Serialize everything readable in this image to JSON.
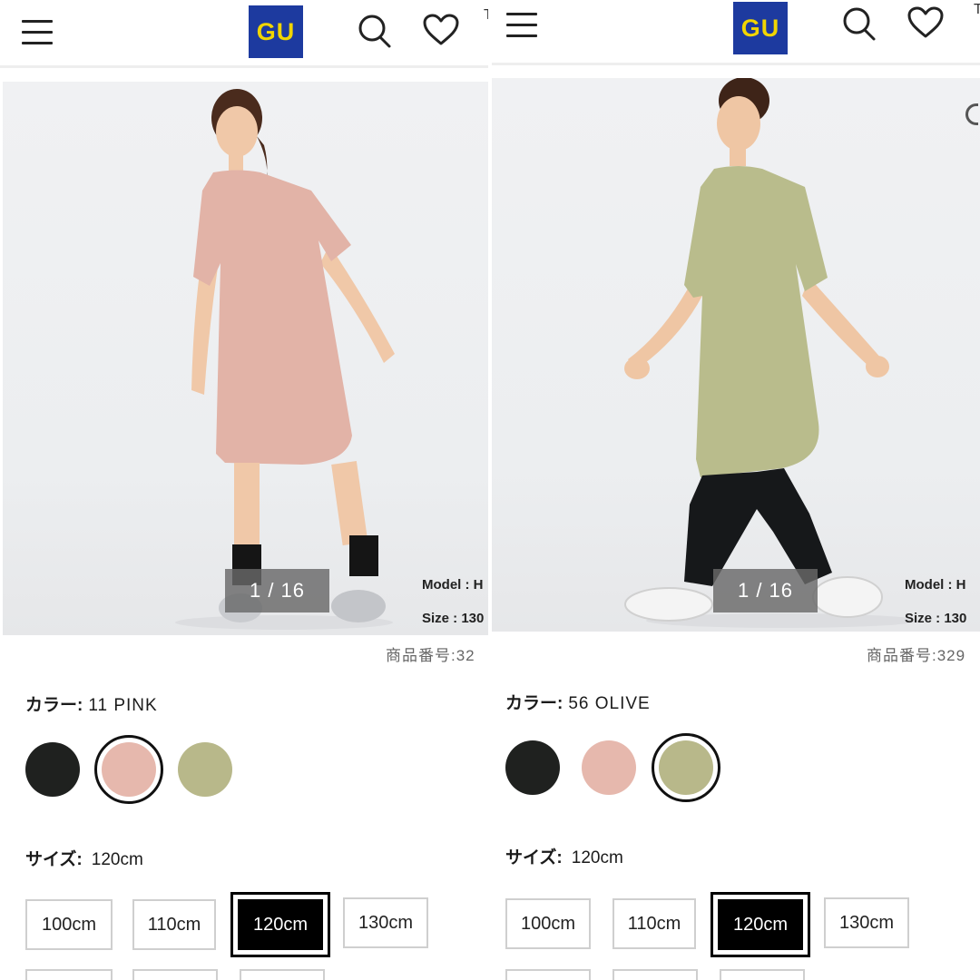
{
  "panels": [
    {
      "header": {
        "logo": "GU",
        "edge_text": "T"
      },
      "photo": {
        "counter": "1 / 16",
        "model": "Model : H",
        "size": "Size : 130",
        "dress_color": "#e2b3a7",
        "edge_icon": ""
      },
      "product_id": "商品番号:32",
      "color": {
        "label": "カラー:",
        "value": "11 PINK",
        "swatches": [
          {
            "name": "black",
            "hex": "#1f211f",
            "selected": false
          },
          {
            "name": "pink",
            "hex": "#e6b8ad",
            "selected": true
          },
          {
            "name": "olive",
            "hex": "#b8b88a",
            "selected": false
          }
        ]
      },
      "size": {
        "label": "サイズ:",
        "value": "120cm",
        "options": [
          "100cm",
          "110cm",
          "120cm",
          "130cm"
        ],
        "selected": "120cm"
      }
    },
    {
      "header": {
        "logo": "GU",
        "edge_text": "T"
      },
      "photo": {
        "counter": "1 / 16",
        "model": "Model : H",
        "size": "Size : 130",
        "dress_color": "#b9bc8c",
        "edge_icon": "circle-edge"
      },
      "product_id": "商品番号:329",
      "color": {
        "label": "カラー:",
        "value": "56 OLIVE",
        "swatches": [
          {
            "name": "black",
            "hex": "#1f211f",
            "selected": false
          },
          {
            "name": "pink",
            "hex": "#e6b8ad",
            "selected": false
          },
          {
            "name": "olive",
            "hex": "#b8b88a",
            "selected": true
          }
        ]
      },
      "size": {
        "label": "サイズ:",
        "value": "120cm",
        "options": [
          "100cm",
          "110cm",
          "120cm",
          "130cm"
        ],
        "selected": "120cm"
      }
    }
  ],
  "icons": {
    "menu": "hamburger-icon",
    "search": "search-icon",
    "favorite": "heart-icon"
  },
  "colors": {
    "logo_bg": "#1d3a9f",
    "logo_text": "#f1d500",
    "selected_size_bg": "#000000"
  }
}
